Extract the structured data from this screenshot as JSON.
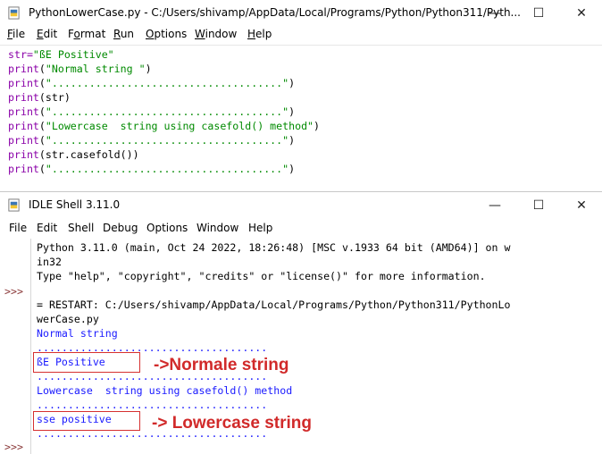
{
  "editor": {
    "title": "PythonLowerCase.py - C:/Users/shivamp/AppData/Local/Programs/Python/Python311/Pyth...",
    "menu": [
      "File",
      "Edit",
      "Format",
      "Run",
      "Options",
      "Window",
      "Help"
    ],
    "menu_underline": [
      "F",
      "E",
      "o",
      "R",
      "O",
      "W",
      "H"
    ],
    "code": [
      {
        "pre": "",
        "kw": "str=",
        "s": "\"ßE Positive\"",
        "post": ""
      },
      {
        "pre": "",
        "kw": "print",
        "s": "(\"Normal string \")",
        "post": ""
      },
      {
        "pre": "",
        "kw": "print",
        "s": "(\".....................................\")",
        "post": ""
      },
      {
        "pre": "",
        "kw": "print",
        "s": "",
        "post": "(str)"
      },
      {
        "pre": "",
        "kw": "print",
        "s": "(\".....................................\")",
        "post": ""
      },
      {
        "pre": "",
        "kw": "print",
        "s": "(\"Lowercase  string using casefold() method\")",
        "post": ""
      },
      {
        "pre": "",
        "kw": "print",
        "s": "(\".....................................\")",
        "post": ""
      },
      {
        "pre": "",
        "kw": "print",
        "s": "",
        "post": "(str.casefold())"
      },
      {
        "pre": "",
        "kw": "print",
        "s": "(\".....................................\")",
        "post": ""
      }
    ]
  },
  "shell": {
    "title": "IDLE Shell 3.11.0",
    "menu": [
      "File",
      "Edit",
      "Shell",
      "Debug",
      "Options",
      "Window",
      "Help"
    ],
    "prompts": [
      ">>>",
      ">>>"
    ],
    "lines": [
      {
        "text": "Python 3.11.0 (main, Oct 24 2022, 18:26:48) [MSC v.1933 64 bit (AMD64)] on w",
        "kind": "plain"
      },
      {
        "text": "in32",
        "kind": "plain"
      },
      {
        "text": "Type \"help\", \"copyright\", \"credits\" or \"license()\" for more information.",
        "kind": "plain"
      },
      {
        "text": "",
        "kind": "plain"
      },
      {
        "text": "= RESTART: C:/Users/shivamp/AppData/Local/Programs/Python/Python311/PythonLo",
        "kind": "plain"
      },
      {
        "text": "werCase.py",
        "kind": "plain"
      },
      {
        "text": "Normal string",
        "kind": "out"
      },
      {
        "text": ".....................................",
        "kind": "out"
      },
      {
        "text": "ßE Positive",
        "kind": "out"
      },
      {
        "text": ".....................................",
        "kind": "out"
      },
      {
        "text": "Lowercase  string using casefold() method",
        "kind": "out"
      },
      {
        "text": ".....................................",
        "kind": "out"
      },
      {
        "text": "sse positive",
        "kind": "out"
      },
      {
        "text": ".....................................",
        "kind": "out"
      }
    ]
  },
  "annotations": {
    "normal": "->Normale string",
    "lower": "-> Lowercase string",
    "color": "#d12a2a"
  },
  "window_controls": {
    "minimize": "—",
    "maximize": "☐",
    "close": "✕"
  }
}
